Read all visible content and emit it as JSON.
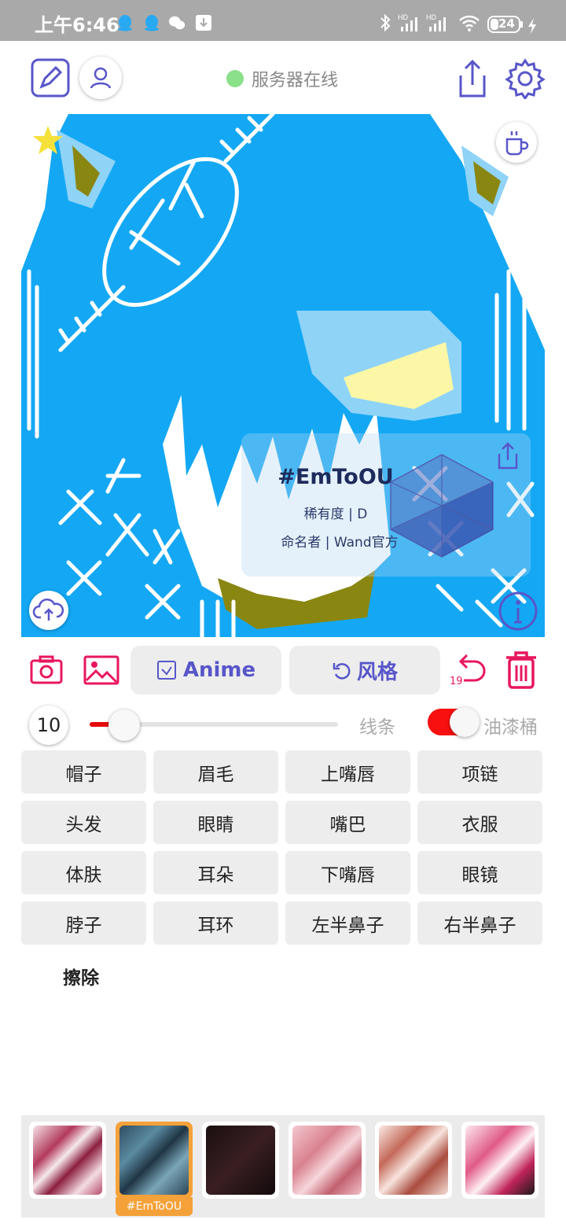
{
  "status_bar": {
    "time": "上午6:46",
    "battery": "24"
  },
  "header": {
    "server_status": "服务器在线"
  },
  "card": {
    "title": "#EmToOU",
    "rarity": "稀有度 | D",
    "namer": "命名者 | Wand官方"
  },
  "toolbar": {
    "anime_label": "Anime",
    "style_label": "风格",
    "undo_count": "19"
  },
  "brush": {
    "size": "10",
    "size_level": 0.14,
    "line_label": "线条",
    "bucket_label": "油漆桶",
    "bucket_enabled": true
  },
  "parts": [
    "帽子",
    "眉毛",
    "上嘴唇",
    "项链",
    "头发",
    "眼睛",
    "嘴巴",
    "衣服",
    "体肤",
    "耳朵",
    "下嘴唇",
    "眼镜",
    "脖子",
    "耳环",
    "左半鼻子",
    "右半鼻子"
  ],
  "erase_label": "擦除",
  "styles": {
    "selected_caption": "#EmToOU"
  },
  "colors": {
    "accent": "#5856c9",
    "red": "#e8175d",
    "canvas_blue": "#14a8f4"
  }
}
